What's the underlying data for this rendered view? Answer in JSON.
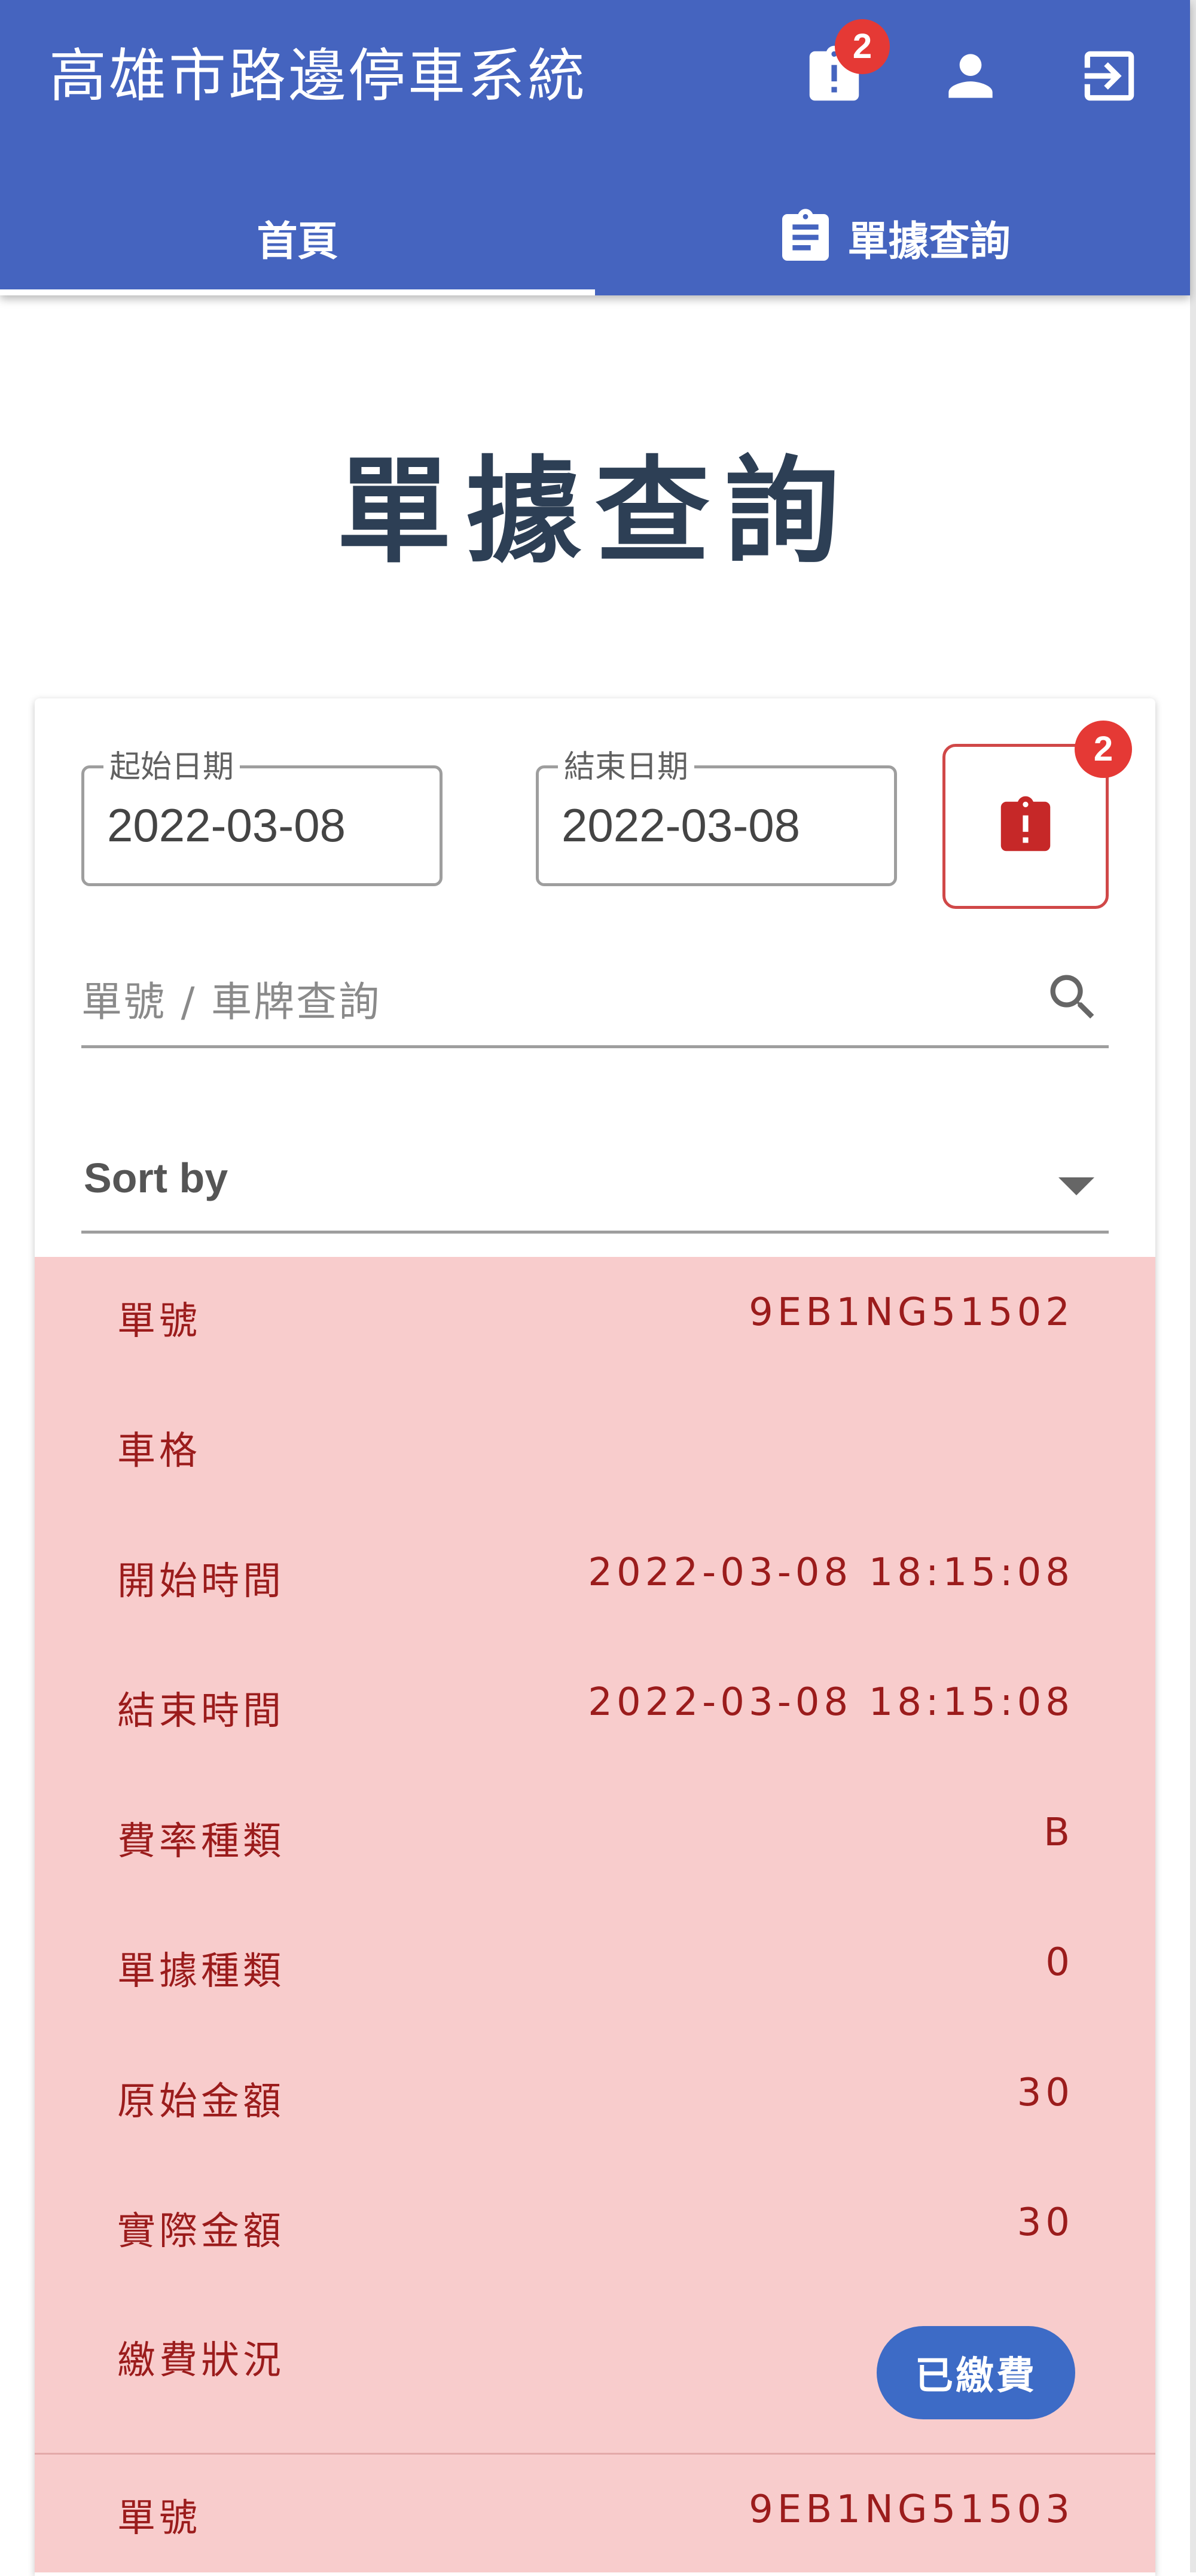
{
  "app": {
    "title": "高雄市路邊停車系統",
    "notification_count": "2"
  },
  "icons": {
    "alert": "clipboard-alert-icon",
    "user": "account-icon",
    "logout": "logout-icon",
    "tab_receipt": "clipboard-text-icon",
    "search": "search-icon",
    "dropdown": "caret-down-icon"
  },
  "tabs": [
    {
      "label": "首頁"
    },
    {
      "label": "單據查詢"
    }
  ],
  "page": {
    "title": "單據查詢"
  },
  "filters": {
    "start_label": "起始日期",
    "start_value": "2022-03-08",
    "end_label": "結束日期",
    "end_value": "2022-03-08",
    "alert_count": "2",
    "search_placeholder": "單號 / 車牌查詢",
    "sort_label": "Sort by"
  },
  "colors": {
    "primary": "#4564bf",
    "ticket_bg": "#f8cccc",
    "ticket_text": "#9b1c1c",
    "alert": "#d04848",
    "badge": "#e53935",
    "paid_button": "#3d6bc6"
  },
  "tickets": [
    {
      "rows": [
        {
          "label": "單號",
          "value": "9EB1NG51502"
        },
        {
          "label": "車格",
          "value": ""
        },
        {
          "label": "開始時間",
          "value": "2022-03-08 18:15:08"
        },
        {
          "label": "結束時間",
          "value": "2022-03-08 18:15:08"
        },
        {
          "label": "費率種類",
          "value": "B"
        },
        {
          "label": "單據種類",
          "value": "0"
        },
        {
          "label": "原始金額",
          "value": "30"
        },
        {
          "label": "實際金額",
          "value": "30"
        },
        {
          "label": "繳費狀況",
          "value": ""
        }
      ],
      "status_button": "已繳費"
    },
    {
      "rows": [
        {
          "label": "單號",
          "value": "9EB1NG51503"
        }
      ]
    }
  ]
}
